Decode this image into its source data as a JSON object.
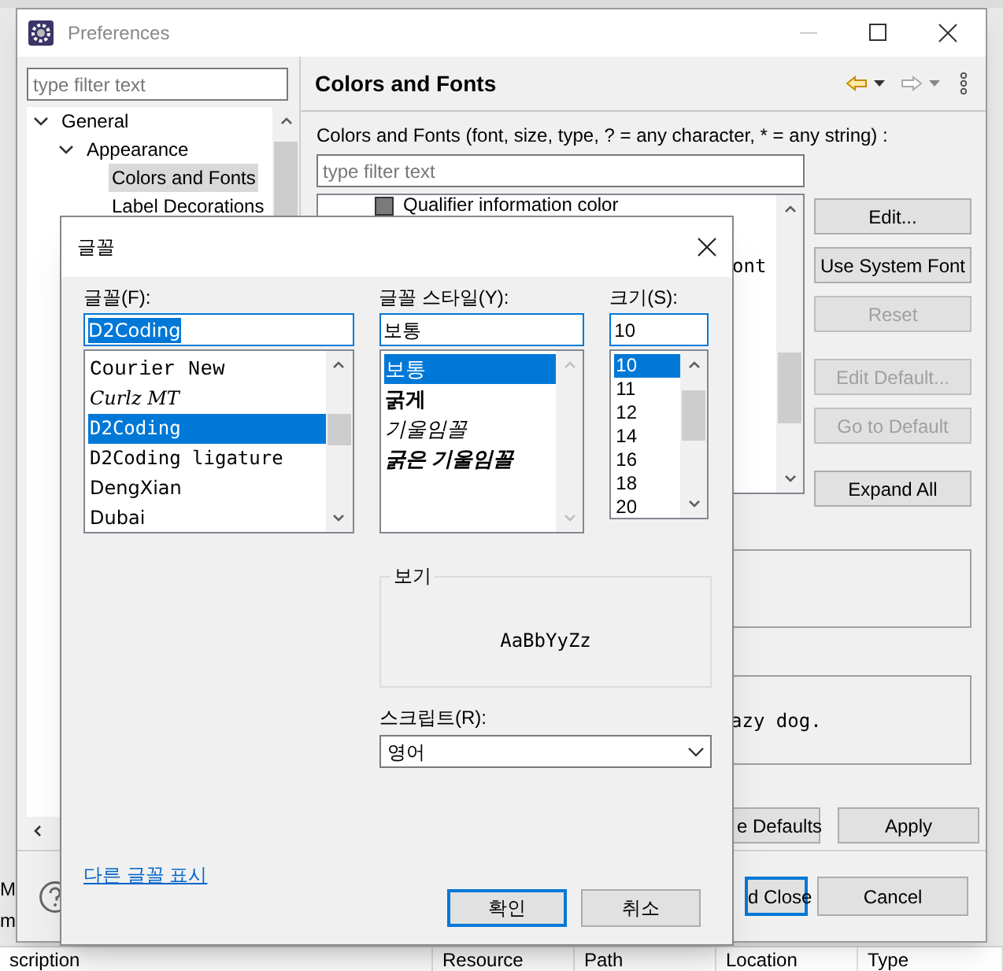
{
  "ide": {
    "edge_texts": [
      "M",
      "m"
    ],
    "columns": [
      "scription",
      "Resource",
      "Path",
      "Location",
      "Type"
    ]
  },
  "preferences": {
    "title": "Preferences",
    "filter_placeholder": "type filter text",
    "tree": [
      {
        "label": "General",
        "expanded": true,
        "selected": false,
        "children": [
          {
            "label": "Appearance",
            "expanded": true,
            "selected": false,
            "children": [
              {
                "label": "Colors and Fonts",
                "selected": true
              },
              {
                "label": "Label Decorations",
                "selected": false
              }
            ]
          }
        ]
      }
    ],
    "page_title": "Colors and Fonts",
    "description": "Colors and Fonts (font, size, type, ? = any character, * = any string) :",
    "page_filter_placeholder": "type filter text",
    "theme_items": [
      {
        "kind": "color",
        "label": "Qualifier information color"
      },
      {
        "kind": "font",
        "label": "ont"
      }
    ],
    "side_buttons": [
      {
        "label": "Edit...",
        "disabled": false
      },
      {
        "label": "Use System Font",
        "disabled": false
      },
      {
        "label": "Reset",
        "disabled": true
      },
      {
        "label": "Edit Default...",
        "disabled": true
      },
      {
        "label": "Go to Default",
        "disabled": true
      },
      {
        "label": "Expand All",
        "disabled": false
      }
    ],
    "preview_text": "azy dog.",
    "page_buttons": [
      {
        "label": "e Defaults"
      },
      {
        "label": "Apply"
      }
    ],
    "dialog_buttons": [
      {
        "label": "d Close",
        "default": true
      },
      {
        "label": "Cancel",
        "default": false
      }
    ]
  },
  "font_dialog": {
    "title": "글꼴",
    "font": {
      "label": "글꼴(F):",
      "value": "D2Coding",
      "items": [
        {
          "label": "Courier New",
          "kind": "mono",
          "selected": false
        },
        {
          "label": "Curlz MT",
          "kind": "serif",
          "selected": false
        },
        {
          "label": "D2Coding",
          "kind": "code",
          "selected": true
        },
        {
          "label": "D2Coding ligature",
          "kind": "code",
          "selected": false
        },
        {
          "label": "DengXian",
          "kind": "sans",
          "selected": false
        },
        {
          "label": "Dubai",
          "kind": "sans",
          "selected": false
        }
      ]
    },
    "style": {
      "label": "글꼴 스타일(Y):",
      "value": "보통",
      "items": [
        {
          "label": "보통",
          "kind": "regular",
          "selected": true
        },
        {
          "label": "굵게",
          "kind": "bold",
          "selected": false
        },
        {
          "label": "기울임꼴",
          "kind": "italic",
          "selected": false
        },
        {
          "label": "굵은 기울임꼴",
          "kind": "bold-italic",
          "selected": false
        }
      ]
    },
    "size": {
      "label": "크기(S):",
      "value": "10",
      "items": [
        {
          "label": "10",
          "selected": true
        },
        {
          "label": "11",
          "selected": false
        },
        {
          "label": "12",
          "selected": false
        },
        {
          "label": "14",
          "selected": false
        },
        {
          "label": "16",
          "selected": false
        },
        {
          "label": "18",
          "selected": false
        },
        {
          "label": "20",
          "selected": false
        }
      ]
    },
    "sample": {
      "label": "보기",
      "text": "AaBbYyZz"
    },
    "script": {
      "label": "스크립트(R):",
      "value": "영어"
    },
    "link": "다른 글꼴 표시",
    "buttons": [
      {
        "label": "확인",
        "default": true
      },
      {
        "label": "취소",
        "default": false
      }
    ]
  }
}
